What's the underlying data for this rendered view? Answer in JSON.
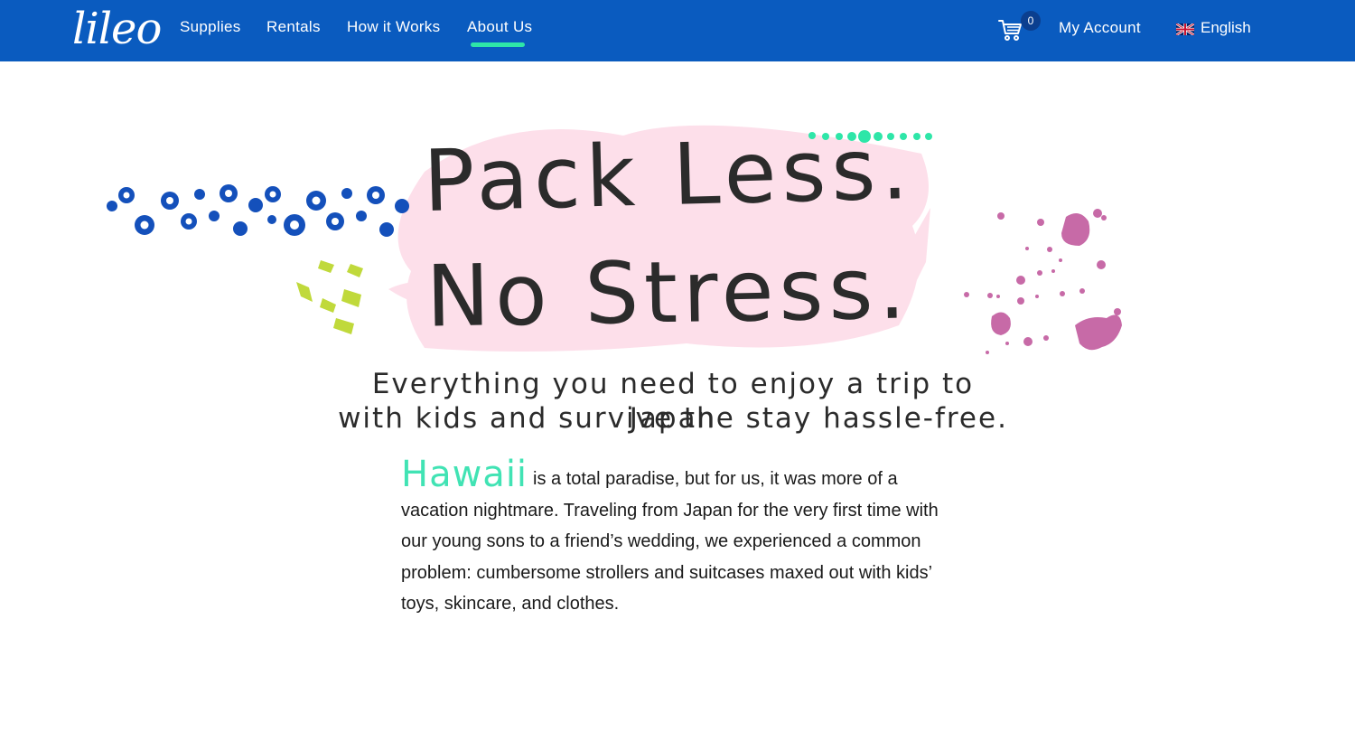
{
  "nav": {
    "logo": "lileo",
    "links": [
      "Supplies",
      "Rentals",
      "How it Works",
      "About Us"
    ],
    "active": "About Us",
    "cart_count": "0",
    "account": "My Account",
    "language": "English"
  },
  "colors": {
    "nav_bg": "#0a5bbf",
    "accent_mint": "#2ee6a8",
    "brush_pink": "#fddfea",
    "dots_blue": "#1450bb",
    "splash_pink": "#c76aa7",
    "dash_lime": "#c0d93b"
  },
  "hero": {
    "line1": "Pack Less.",
    "line2": "No Stress.",
    "sub_line1": "Everything you need to enjoy a trip to Japan",
    "sub_line2": "with kids and survive the stay hassle-free."
  },
  "story": {
    "lead_word": "Hawaii",
    "text": "is a total paradise, but for us, it was more of a vacation nightmare. Traveling from Japan for the very first time with our young sons to a friend’s wedding, we experienced a common problem: cumbersome strollers and suitcases maxed out with kids’ toys, skincare, and clothes."
  },
  "icons": {
    "cart": "cart-icon",
    "flag": "uk-flag-icon"
  }
}
